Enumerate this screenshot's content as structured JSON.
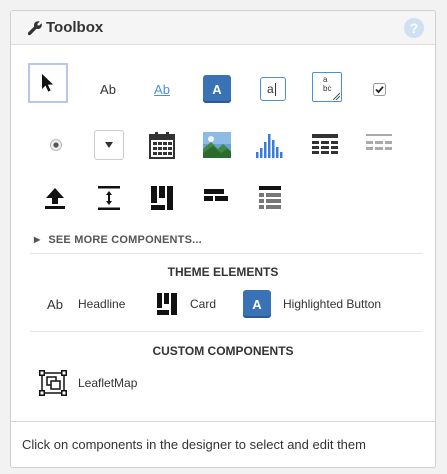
{
  "panel": {
    "title": "Toolbox",
    "help_icon_glyph": "?"
  },
  "components": {
    "row1": [
      {
        "name": "pointer-tool",
        "icon": "cursor-arrow-icon"
      },
      {
        "name": "text-label",
        "text": "Ab",
        "icon": "text-ab-icon"
      },
      {
        "name": "link",
        "text": "Ab",
        "icon": "link-ab-icon"
      },
      {
        "name": "button",
        "text": "A",
        "icon": "button-a-icon"
      },
      {
        "name": "text-input",
        "text": "a",
        "icon": "text-input-icon"
      },
      {
        "name": "text-area",
        "text_top": "a",
        "text_bottom": "bc",
        "icon": "textarea-icon"
      },
      {
        "name": "checkbox",
        "icon": "checkbox-icon"
      }
    ],
    "row2": [
      {
        "name": "radio-button",
        "icon": "radio-button-icon"
      },
      {
        "name": "dropdown",
        "icon": "dropdown-icon"
      },
      {
        "name": "date-picker",
        "icon": "calendar-icon"
      },
      {
        "name": "image",
        "icon": "image-icon"
      },
      {
        "name": "plot",
        "icon": "bar-chart-icon"
      },
      {
        "name": "data-grid",
        "icon": "data-grid-icon"
      },
      {
        "name": "repeating-panel",
        "icon": "repeating-panel-icon"
      }
    ],
    "row3": [
      {
        "name": "file-loader",
        "icon": "upload-icon"
      },
      {
        "name": "spacer",
        "icon": "spacer-icon"
      },
      {
        "name": "column-panel",
        "icon": "column-panel-icon"
      },
      {
        "name": "flow-panel",
        "icon": "flow-panel-icon"
      },
      {
        "name": "linear-panel",
        "icon": "linear-panel-icon"
      }
    ]
  },
  "see_more": {
    "label": "SEE MORE COMPONENTS..."
  },
  "theme_elements": {
    "title": "THEME ELEMENTS",
    "items": [
      {
        "label": "Headline",
        "icon_text": "Ab",
        "icon": "headline-icon"
      },
      {
        "label": "Card",
        "icon": "card-icon"
      },
      {
        "label": "Highlighted Button",
        "icon_text": "A",
        "icon": "highlighted-button-icon"
      }
    ]
  },
  "custom_components": {
    "title": "CUSTOM COMPONENTS",
    "items": [
      {
        "label": "LeafletMap",
        "icon": "custom-component-icon"
      }
    ]
  },
  "footer": {
    "message": "Click on components in the designer to select and edit them"
  },
  "colors": {
    "accent_blue": "#3a73b5",
    "link_blue": "#4a90d6",
    "selection_border": "#b9c6ea",
    "chart_blue": "#3b7cd6",
    "image_green": "#3f8a3f",
    "text_dark": "#333333"
  }
}
